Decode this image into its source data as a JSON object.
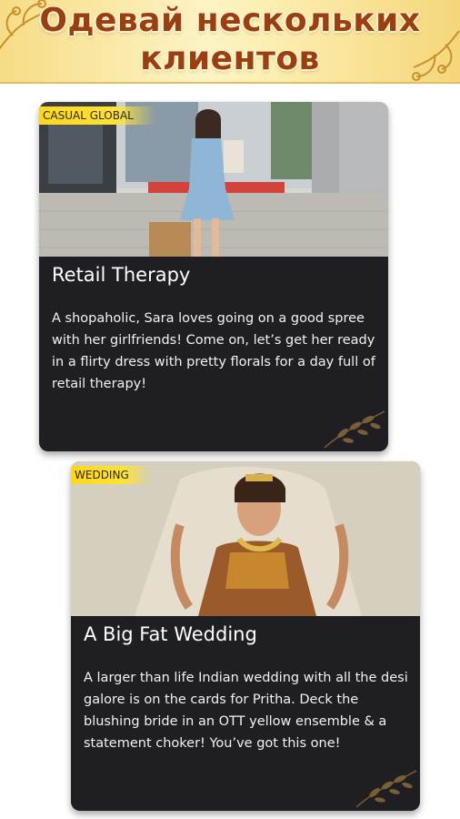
{
  "header": {
    "title_line1": "Одевай нескольких",
    "title_line2": "клиентов"
  },
  "cards": [
    {
      "tag": "CASUAL GLOBAL",
      "title": "Retail Therapy",
      "description": "A shopaholic, Sara loves going on a good spree with her girlfriends! Come on, let’s get her ready in a flirty dress with pretty florals for a day full of retail therapy!"
    },
    {
      "tag": "WEDDING",
      "title": "A Big Fat Wedding",
      "description": "A larger than life Indian wedding with all the desi galore is on the cards for Pritha. Deck the blushing bride in an OTT yellow ensemble & a statement choker! You’ve got this one!"
    }
  ],
  "colors": {
    "banner_gold": "#f6dc86",
    "title_brown": "#9a3f12",
    "card_dark": "#1f1f23",
    "tag_yellow": "#ffd61a"
  }
}
